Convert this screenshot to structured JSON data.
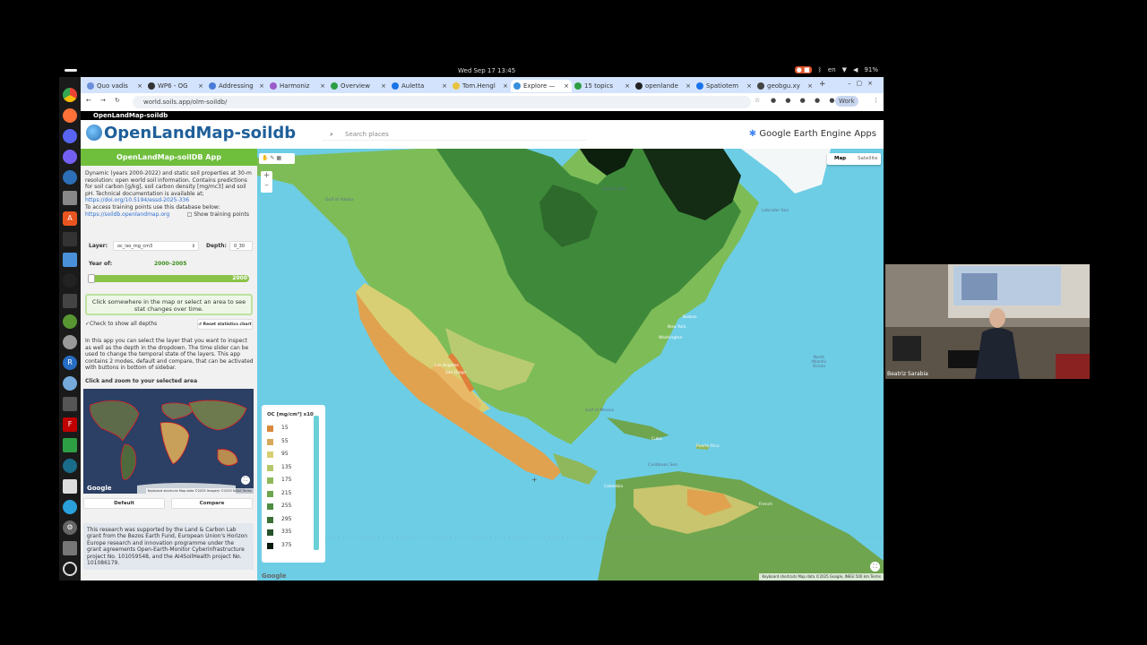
{
  "system": {
    "clock": "Wed Sep 17  13:45",
    "language": "en",
    "battery": "91%"
  },
  "tabs": [
    {
      "label": "Quo vadis"
    },
    {
      "label": "WP6 - OG"
    },
    {
      "label": "Addressing"
    },
    {
      "label": "Harmoniz"
    },
    {
      "label": "Overview"
    },
    {
      "label": "Auletta"
    },
    {
      "label": "Tom.Hengl"
    },
    {
      "label": "Explore —",
      "active": true
    },
    {
      "label": "15 topics"
    },
    {
      "label": "openlande"
    },
    {
      "label": "Spatiotem"
    },
    {
      "label": "geobgu.xy"
    }
  ],
  "browser": {
    "url": "world.soils.app/olm-soildb/",
    "profile": "Work",
    "bookmark": "OpenLandMap-soildb"
  },
  "header": {
    "logo": "OpenLandMap-soildb",
    "search_placeholder": "Search places",
    "gee": "Google Earth Engine Apps"
  },
  "sidebar": {
    "title": "OpenLandMap-soilDB App",
    "description": "Dynamic (years 2000-2022) and static soil properties at 30-m resolution: open world soil information. Contains predictions for soil carbon [g/kg], soil carbon density [mg/mc3] and soil pH. Technical documentation is available at;",
    "doi_link": "https://doi.org/10.5194/essd-2025-336",
    "training_note": "To access training points use this database below:",
    "training_link": "https://soildb.openlandmap.org",
    "show_training": "Show training points",
    "layer_label": "Layer:",
    "layer_value": "oc_iso_mg_cm3",
    "depth_label": "Depth:",
    "depth_value": "0_30",
    "year_label": "Year of:",
    "year_value": "2000–2005",
    "slider_value": "2000",
    "click_hint": "Click somewhere in the map or select an area to see stat changes over time.",
    "check_depths": "Check to show all depths",
    "reset_btn": "Reset statistics chart",
    "info": "In this app you can select the layer that you want to inspect as well as the depth in the dropdown. The time slider can be used to change the temporal state of the layers. This app contains 2 modes, default and compare, that can be activated with buttons in bottom of sidebar.",
    "zoom_title": "Click and zoom to your selected area",
    "minimap_attrib": "Keyboard shortcuts   Map data ©2025 Imagery ©2025 NASA   Terms",
    "default_btn": "Default",
    "compare_btn": "Compare",
    "funding": "This research was supported by the Land & Carbon Lab grant from the Bezos Earth Fund, European Union's Horizon Europe research and innovation programme under the grant agreements Open-Earth-Monitor Cyberinfrastructure project No. 101059548, and the AI4SoilHealth project No. 101086179."
  },
  "map": {
    "map_btn": "Map",
    "sat_btn": "Satellite",
    "labels": {
      "hudson": "Hudson Bay",
      "labrador": "Labrador Sea",
      "alaska": "Gulf of Alaska",
      "atlantic": "North Atlantic Ocean",
      "boston": "Boston",
      "newyork": "New York",
      "washington": "Washington",
      "losangeles": "Los Angeles",
      "sandiego": "San Diego",
      "gulfmex": "Gulf of Mexico",
      "caribbean": "Caribbean Sea",
      "puertorico": "Puerto Rico",
      "french": "French",
      "colombia": "Colombia",
      "cuba": "Cuba"
    },
    "attribution": "Keyboard shortcuts   Map data ©2025 Google, INEGI   500 km   Terms",
    "google": "Google"
  },
  "legend": {
    "title": "OC [mg/cm³] x10",
    "items": [
      {
        "value": "15",
        "color": "#d9893b"
      },
      {
        "value": "55",
        "color": "#d8a85a"
      },
      {
        "value": "95",
        "color": "#d7cf72"
      },
      {
        "value": "135",
        "color": "#b4c86b"
      },
      {
        "value": "175",
        "color": "#8fb85c"
      },
      {
        "value": "215",
        "color": "#6ea54e"
      },
      {
        "value": "255",
        "color": "#4f8c42"
      },
      {
        "value": "295",
        "color": "#3a7138"
      },
      {
        "value": "335",
        "color": "#24502a"
      },
      {
        "value": "375",
        "color": "#0a1a0a"
      }
    ]
  },
  "webcam": {
    "name": "Beatriz Sarabia"
  }
}
